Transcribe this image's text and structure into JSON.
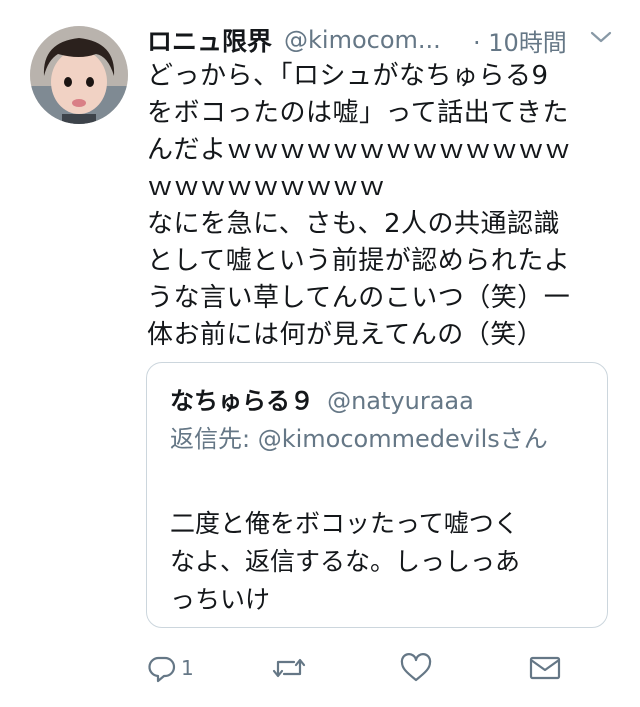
{
  "tweet": {
    "display_name": "ロニュ限界",
    "handle": "@kimocom...",
    "time": "· 10時間",
    "body": "どっから、「ロシュがなちゅらる9\nをボコったのは嘘」って話出てきた\nんだよｗｗｗｗｗｗｗｗｗｗｗｗｗ\nｗｗｗｗｗｗｗｗｗ\nなにを急に、さも、2人の共通認識\nとして嘘という前提が認められたよ\nうな言い草してんのこいつ（笑）一\n体お前には何が見えてんの（笑）"
  },
  "quote": {
    "display_name": "なちゅらる９",
    "handle": "@natyuraaa",
    "reply_to": "返信先: @kimocommedevilsさん",
    "body": "二度と俺をボコッたって嘘つく\nなよ、返信するな。しっしっあ\nっちいけ"
  },
  "actions": {
    "reply_count": "1",
    "icons": [
      "reply-icon",
      "retweet-icon",
      "like-icon",
      "message-icon"
    ]
  },
  "colors": {
    "text": "#14171a",
    "secondary": "#657786",
    "border": "#ccd6dd",
    "background": "#ffffff"
  }
}
